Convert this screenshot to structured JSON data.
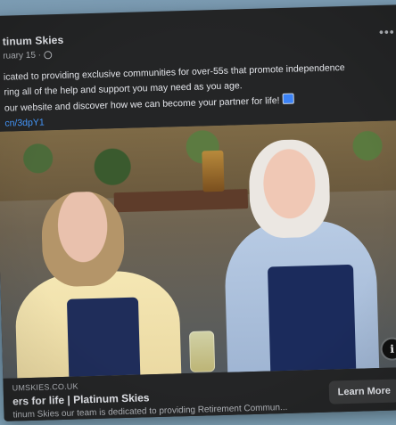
{
  "post": {
    "page_name": "tinum Skies",
    "date": "ruary 15 ·",
    "text_lines": [
      "icated to providing exclusive communities for over-55s that promote independence",
      "ring all of the help and support you may need as you age.",
      "our website and discover how we can become your partner for life!"
    ],
    "short_link": "cn/3dpY1"
  },
  "ad": {
    "domain": "UMSKIES.CO.UK",
    "headline": "ers for life | Platinum Skies",
    "description": "tinum Skies our team is dedicated to providing Retirement Commun...",
    "cta_label": "Learn More"
  },
  "icons": {
    "more": "more-options-icon",
    "globe": "globe-icon",
    "info": "info-icon",
    "link_emoji": "link-emoji-icon"
  },
  "colors": {
    "card_bg": "#242526",
    "text": "#e4e6eb",
    "muted": "#b0b3b8",
    "link": "#4599ff",
    "cta_bg": "#3a3b3c"
  }
}
